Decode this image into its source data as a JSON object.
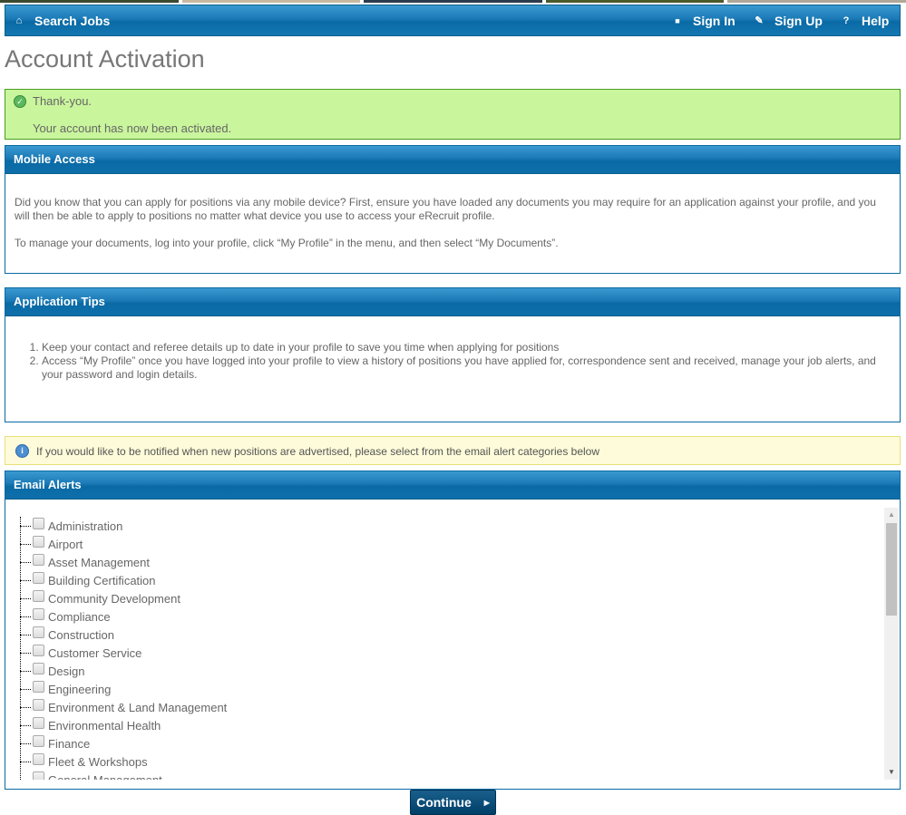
{
  "nav": {
    "search_jobs": "Search Jobs",
    "sign_in": "Sign In",
    "sign_up": "Sign Up",
    "help": "Help",
    "icons": {
      "home": "⌂",
      "lock": "🔒",
      "pencil": "✎",
      "help": "?"
    }
  },
  "page_title": "Account Activation",
  "success": {
    "title": "Thank-you.",
    "message": "Your account has now been activated."
  },
  "mobile_access": {
    "heading": "Mobile Access",
    "para1": "Did you know that you can apply for positions via any mobile device? First, ensure you have loaded any documents you may require for an application against your profile, and you will then be able to apply to positions no matter what device you use to access your eRecruit profile.",
    "para2": "To manage your documents, log into your profile, click “My Profile” in the menu, and then select “My Documents”."
  },
  "application_tips": {
    "heading": "Application Tips",
    "items": [
      "Keep your contact and referee details up to date in your profile to save you time when applying for positions",
      "Access “My Profile” once you have logged into your profile to view a history of positions you have applied for, correspondence sent and received, manage your job alerts, and your password and login details."
    ]
  },
  "info_message": "If you would like to be notified when new positions are advertised, please select from the email alert categories below",
  "email_alerts": {
    "heading": "Email Alerts",
    "categories": [
      {
        "label": "Administration",
        "checked": false
      },
      {
        "label": "Airport",
        "checked": false
      },
      {
        "label": "Asset Management",
        "checked": false
      },
      {
        "label": "Building Certification",
        "checked": false
      },
      {
        "label": "Community Development",
        "checked": false
      },
      {
        "label": "Compliance",
        "checked": false
      },
      {
        "label": "Construction",
        "checked": false
      },
      {
        "label": "Customer Service",
        "checked": false
      },
      {
        "label": "Design",
        "checked": false
      },
      {
        "label": "Engineering",
        "checked": false
      },
      {
        "label": "Environment & Land Management",
        "checked": false
      },
      {
        "label": "Environmental Health",
        "checked": false
      },
      {
        "label": "Finance",
        "checked": false
      },
      {
        "label": "Fleet & Workshops",
        "checked": false
      },
      {
        "label": "General Management",
        "checked": false
      }
    ]
  },
  "continue_label": "Continue",
  "banner_colors": [
    "#3b4a2f",
    "#c9b8a0",
    "#2d3b4d",
    "#4c5a2a",
    "#b0a898"
  ]
}
